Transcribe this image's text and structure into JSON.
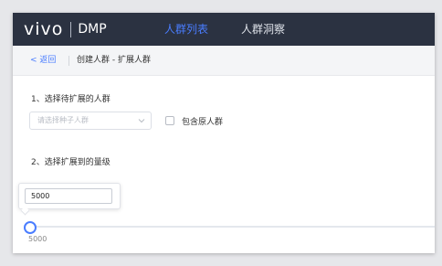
{
  "header": {
    "brand_logo": "vivo",
    "brand_product": "DMP",
    "nav": [
      {
        "label": "人群列表",
        "active": true
      },
      {
        "label": "人群洞察",
        "active": false
      }
    ]
  },
  "breadcrumb": {
    "back_label": "< 返回",
    "title": "创建人群 - 扩展人群"
  },
  "step1": {
    "label": "1、选择待扩展的人群",
    "seed_select_placeholder": "请选择种子人群",
    "include_original_label": "包含原人群",
    "include_original_checked": false
  },
  "step2": {
    "label": "2、选择扩展到的量级",
    "input_value": "5000",
    "slider_value": "5000"
  },
  "colors": {
    "topbar_bg": "#2b3241",
    "accent": "#4a7dff",
    "page_bg": "#ffffff"
  }
}
